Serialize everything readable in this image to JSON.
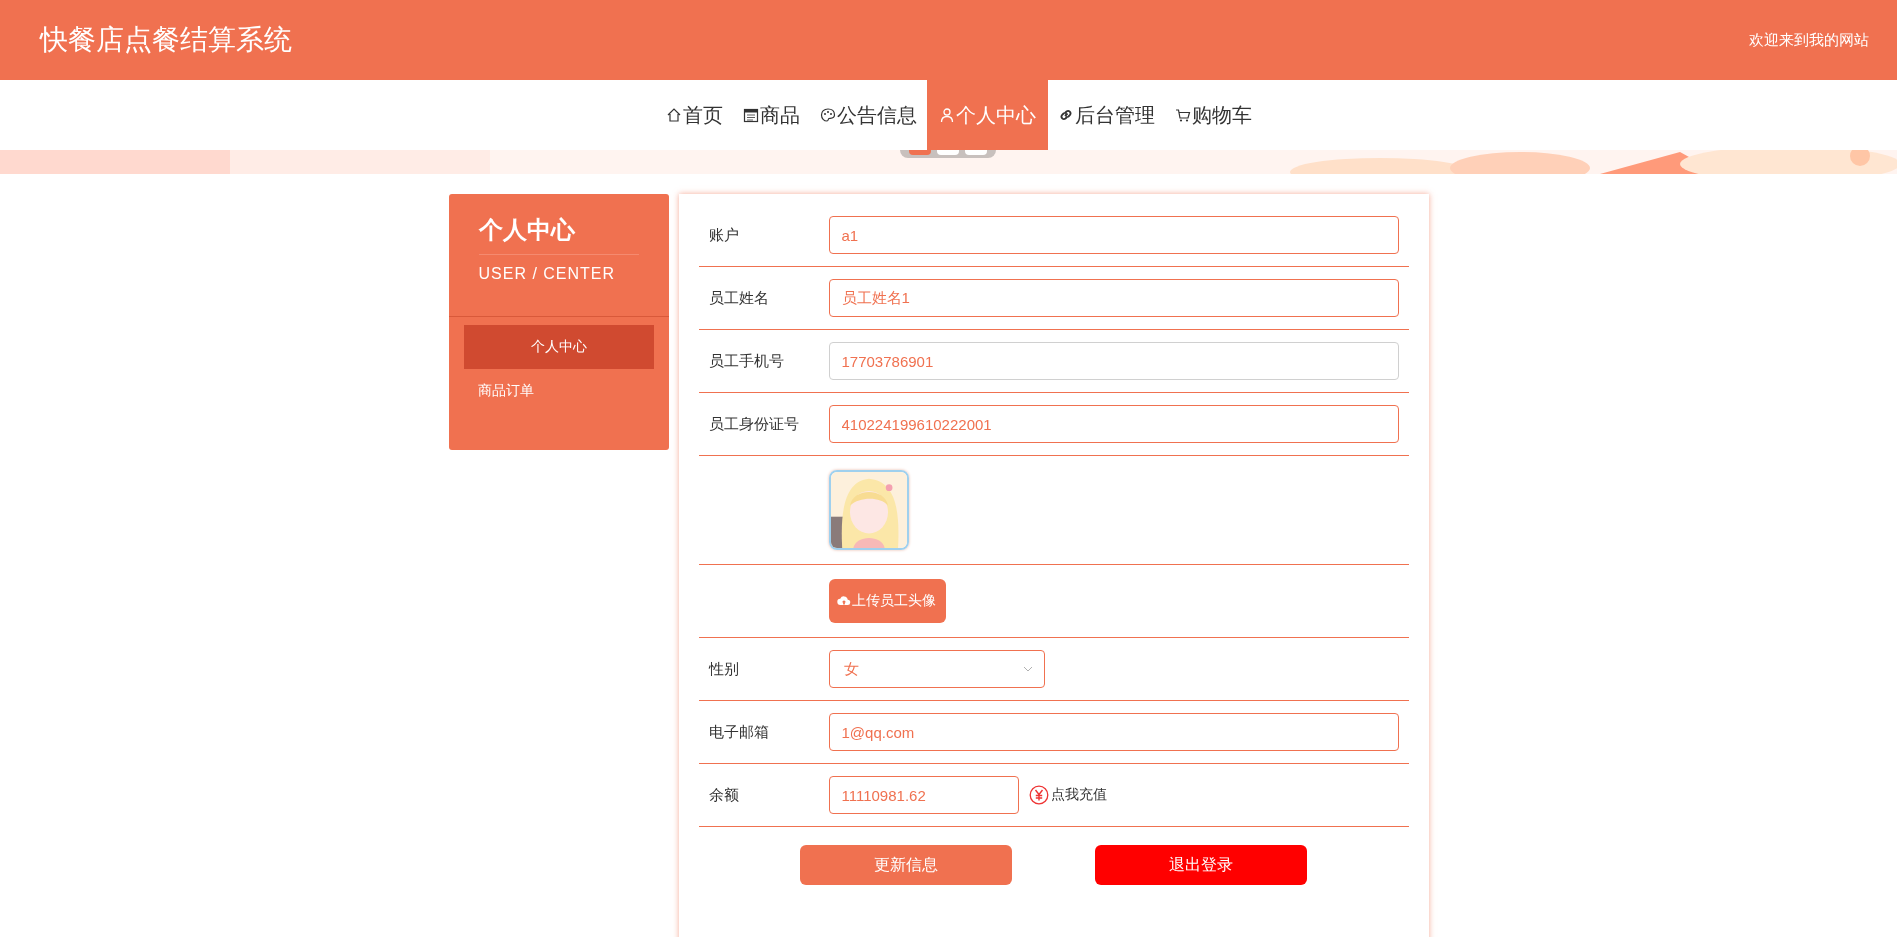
{
  "header": {
    "title": "快餐店点餐结算系统",
    "welcome": "欢迎来到我的网站"
  },
  "nav": [
    {
      "label": "首页",
      "kind": "home",
      "selected": false
    },
    {
      "label": "商品",
      "kind": "goods",
      "selected": false
    },
    {
      "label": "公告信息",
      "kind": "notice",
      "selected": false
    },
    {
      "label": "个人中心",
      "kind": "user",
      "selected": true
    },
    {
      "label": "后台管理",
      "kind": "admin",
      "selected": false
    },
    {
      "label": "购物车",
      "kind": "cart",
      "selected": false
    }
  ],
  "banner": {
    "dots": [
      {
        "selected": true
      },
      {
        "selected": false
      },
      {
        "selected": false
      }
    ]
  },
  "sidebar": {
    "title": "个人中心",
    "subtitle": "USER / CENTER",
    "items": [
      {
        "label": "个人中心",
        "selected": true
      },
      {
        "label": "商品订单",
        "selected": false
      }
    ]
  },
  "form": {
    "fields": [
      {
        "kind": "text",
        "label": "账户",
        "value": "a1"
      },
      {
        "kind": "text",
        "label": "员工姓名",
        "value": "员工姓名1"
      },
      {
        "kind": "text",
        "label": "员工手机号",
        "value": "17703786901",
        "disabled": true
      },
      {
        "kind": "text",
        "label": "员工身份证号",
        "value": "410224199610222001"
      },
      {
        "kind": "avatar"
      },
      {
        "kind": "upload",
        "button": "上传员工头像"
      },
      {
        "kind": "select",
        "label": "性别",
        "value": "女"
      },
      {
        "kind": "text",
        "label": "电子邮箱",
        "value": "1@qq.com"
      },
      {
        "kind": "balance",
        "label": "余额",
        "value": "11110981.62",
        "link": "点我充值"
      }
    ],
    "buttons": [
      {
        "label": "更新信息",
        "kind": "primary"
      },
      {
        "label": "退出登录",
        "kind": "danger"
      }
    ]
  }
}
